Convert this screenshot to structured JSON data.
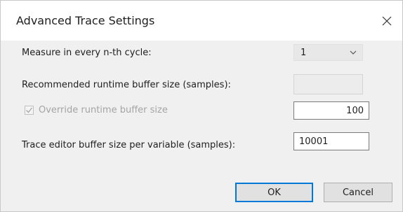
{
  "dialog": {
    "title": "Advanced Trace Settings"
  },
  "measure": {
    "label": "Measure in every n-th cycle:",
    "selected": "1"
  },
  "recommended": {
    "label": "Recommended runtime buffer size (samples):",
    "value": ""
  },
  "override": {
    "label": "Override runtime buffer size",
    "checked": true,
    "enabled": false,
    "value": "100"
  },
  "editor_buffer": {
    "label": "Trace editor buffer size per variable (samples):",
    "value": "10001"
  },
  "buttons": {
    "ok": "OK",
    "cancel": "Cancel"
  },
  "icons": {
    "close": "close-icon",
    "dropdown": "chevron-down-icon",
    "check": "checkmark-icon"
  },
  "colors": {
    "default_button_border": "#0078d7",
    "disabled_text": "#a4a4a4"
  }
}
